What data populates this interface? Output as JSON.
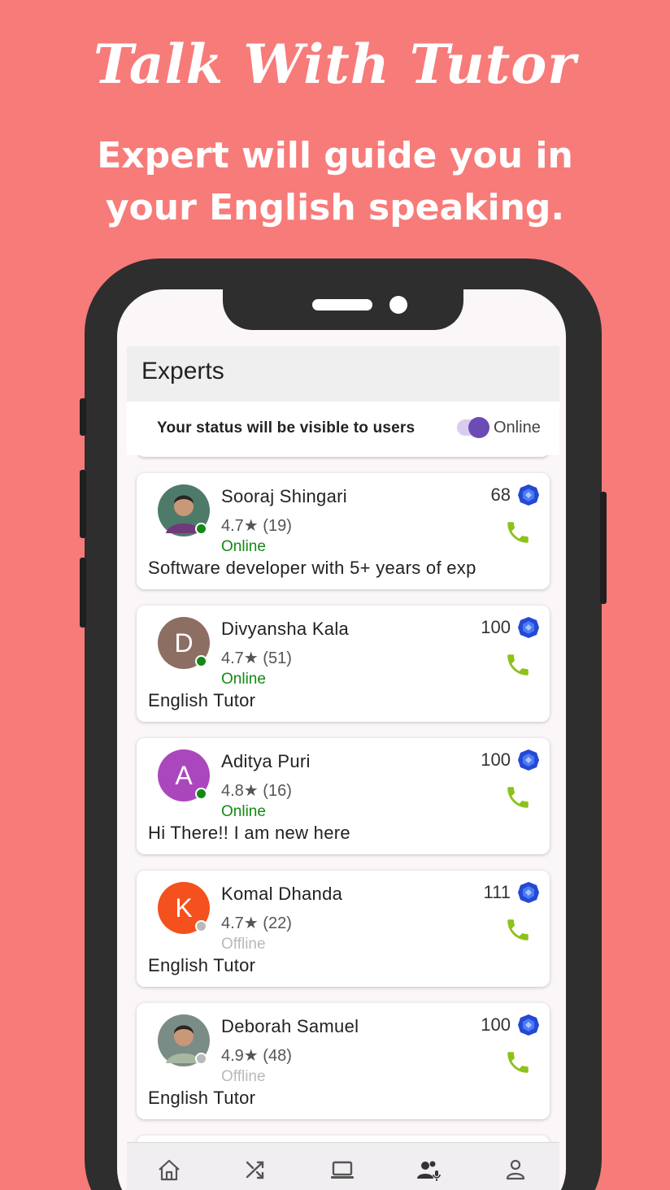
{
  "promo": {
    "headline": "Talk With Tutor",
    "subline": "Expert will guide you in your English speaking."
  },
  "app": {
    "title": "Experts",
    "status_message": "Your status will be visible to users",
    "toggle_label": "Online",
    "toggle_on": true
  },
  "colors": {
    "background": "#f77b79",
    "online": "#138a13",
    "offline": "#b9b9b9",
    "call": "#8cc21c",
    "gem": "#2449d6",
    "toggle": "#6a4cb4"
  },
  "experts": [
    {
      "name": "Sooraj Shingari",
      "rating": "4.7★ (19)",
      "status": "Online",
      "bio": "Software developer with 5+ years of exp",
      "coins": "68",
      "avatar": "photo",
      "avatar_color": "#4e7a6a"
    },
    {
      "name": "Divyansha Kala",
      "rating": "4.7★ (51)",
      "status": "Online",
      "bio": "English Tutor",
      "coins": "100",
      "avatar": "D",
      "avatar_color": "#8d6e63"
    },
    {
      "name": "Aditya Puri",
      "rating": "4.8★ (16)",
      "status": "Online",
      "bio": "Hi There!! I am new here",
      "coins": "100",
      "avatar": "A",
      "avatar_color": "#ab47bc"
    },
    {
      "name": "Komal Dhanda",
      "rating": "4.7★ (22)",
      "status": "Offline",
      "bio": "English Tutor",
      "coins": "111",
      "avatar": "K",
      "avatar_color": "#f4511e"
    },
    {
      "name": "Deborah Samuel",
      "rating": "4.9★ (48)",
      "status": "Offline",
      "bio": "English Tutor",
      "coins": "100",
      "avatar": "photo",
      "avatar_color": "#7a8c86"
    }
  ],
  "bottom_nav": [
    {
      "icon": "home-icon"
    },
    {
      "icon": "shuffle-icon"
    },
    {
      "icon": "laptop-icon"
    },
    {
      "icon": "experts-icon",
      "active": true
    },
    {
      "icon": "profile-icon"
    }
  ]
}
